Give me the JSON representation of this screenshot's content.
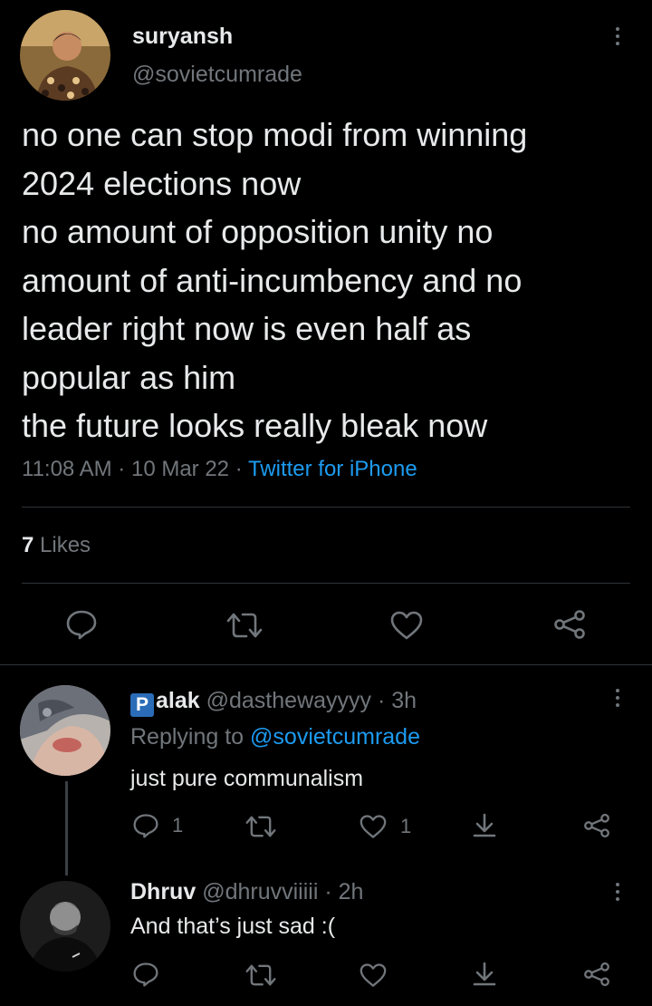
{
  "main_tweet": {
    "author_name": "suryansh",
    "author_handle": "@sovietcumrade",
    "text_lines": [
      "no one can stop modi from winning",
      "2024 elections now",
      "no amount of opposition unity no",
      "amount of anti-incumbency and no",
      "leader right now is even half as",
      "popular as him",
      "the future looks really bleak now"
    ],
    "time": "11:08 AM",
    "date": "10 Mar 22",
    "separator": "·",
    "source": "Twitter for iPhone",
    "likes_count": "7",
    "likes_label": "Likes"
  },
  "replies": [
    {
      "badge": "P",
      "author_name": "alak",
      "author_handle": "@dasthewayyyy",
      "separator": "·",
      "age": "3h",
      "replying_prefix": "Replying to",
      "replying_to": "@sovietcumrade",
      "text": "just pure communalism",
      "reply_count": "1",
      "like_count": "1"
    },
    {
      "author_name": "Dhruv",
      "author_handle": "@dhruvviiiii",
      "separator": "·",
      "age": "2h",
      "text": "And that’s just sad :("
    }
  ],
  "icons": {
    "reply": "reply-icon",
    "retweet": "retweet-icon",
    "like": "heart-icon",
    "share": "share-icon",
    "download": "download-icon",
    "more": "more-icon"
  },
  "colors": {
    "background": "#000000",
    "text": "#e7e9ea",
    "muted": "#71767b",
    "link": "#1d9bf0",
    "divider": "#2f3336"
  }
}
